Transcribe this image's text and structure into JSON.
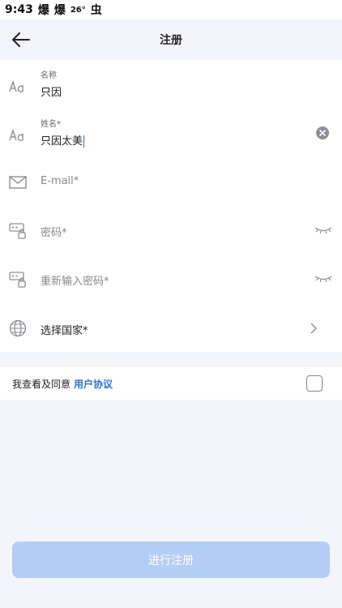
{
  "status_bar": {
    "time": "9:43",
    "icon1": "爆",
    "icon2": "爆",
    "temperature": "26°",
    "icon3": "虫"
  },
  "header": {
    "title": "注册",
    "back_icon": "arrow-left-icon"
  },
  "form": {
    "nickname": {
      "label": "名称",
      "value": "只因",
      "icon": "font-icon"
    },
    "name": {
      "label": "姓名*",
      "value": "只因太美",
      "icon": "font-icon",
      "clear_icon": "clear-circle-icon"
    },
    "email": {
      "placeholder": "E-mail*",
      "icon": "mail-icon"
    },
    "password": {
      "placeholder": "密码*",
      "icon": "password-icon",
      "toggle_icon": "eye-closed-icon"
    },
    "confirm_password": {
      "placeholder": "重新输入密码*",
      "icon": "password-icon",
      "toggle_icon": "eye-closed-icon"
    },
    "country": {
      "label": "选择国家*",
      "icon": "globe-icon",
      "chevron_icon": "chevron-right-icon"
    }
  },
  "agreement": {
    "text": "我查看及同意",
    "link": "用户协议",
    "checked": false
  },
  "submit": {
    "label": "进行注册"
  },
  "colors": {
    "background": "#f4f5fa",
    "card": "#ffffff",
    "link": "#2f6fd6",
    "button_disabled": "#b3cdf6",
    "icon": "#8b8d95"
  }
}
